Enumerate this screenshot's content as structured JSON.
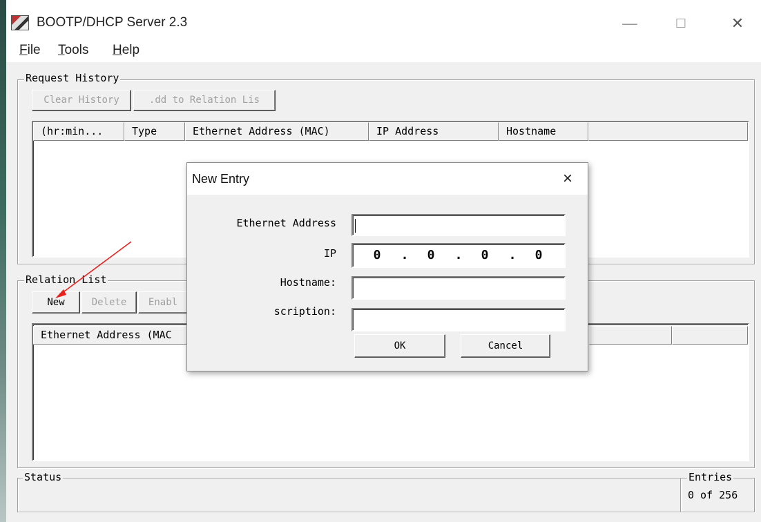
{
  "window": {
    "title": "BOOTP/DHCP Server 2.3",
    "controls": {
      "minimize": "—",
      "maximize": "☐",
      "close": "✕"
    }
  },
  "menu": {
    "file": {
      "mnemonic": "F",
      "rest": "ile"
    },
    "tools": {
      "mnemonic": "T",
      "rest": "ools"
    },
    "help": {
      "mnemonic": "H",
      "rest": "elp"
    }
  },
  "request_history": {
    "title": "Request History",
    "clear_history_label": "Clear History",
    "add_to_relation_label": ".dd to Relation Lis",
    "columns": [
      "(hr:min...",
      "Type",
      "Ethernet Address (MAC)",
      "IP Address",
      "Hostname",
      ""
    ]
  },
  "relation_list": {
    "title": "Relation List",
    "new_label": "New",
    "delete_label": "Delete",
    "enable_label": "Enabl",
    "columns": [
      "Ethernet Address (MAC",
      "",
      ""
    ]
  },
  "status": {
    "title": "Status",
    "entries_title": "Entries",
    "entries_value": "0 of 256"
  },
  "dialog": {
    "title": "New Entry",
    "close_icon": "×",
    "ethernet_label": "Ethernet Address",
    "ethernet_value": "",
    "ip_label": "IP",
    "ip_octets": [
      "0",
      "0",
      "0",
      "0"
    ],
    "ip_dot": ".",
    "hostname_label": "Hostname:",
    "hostname_value": "",
    "description_label": "scription:",
    "description_value": "",
    "ok_label": "OK",
    "cancel_label": "Cancel"
  },
  "colors": {
    "face": "#f0f0f0",
    "annotation_arrow": "#e8221e"
  }
}
